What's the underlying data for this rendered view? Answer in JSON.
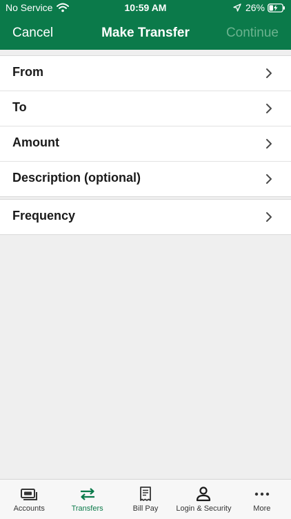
{
  "status_bar": {
    "carrier": "No Service",
    "time": "10:59 AM",
    "battery": "26%"
  },
  "nav": {
    "cancel_label": "Cancel",
    "title": "Make Transfer",
    "continue_label": "Continue"
  },
  "form": {
    "group1": [
      {
        "label": "From"
      },
      {
        "label": "To"
      },
      {
        "label": "Amount"
      },
      {
        "label": "Description (optional)"
      }
    ],
    "group2": [
      {
        "label": "Frequency"
      }
    ]
  },
  "tabbar": {
    "active": "Transfers",
    "items": [
      {
        "label": "Accounts",
        "icon": "accounts-icon"
      },
      {
        "label": "Transfers",
        "icon": "transfers-icon"
      },
      {
        "label": "Bill Pay",
        "icon": "bill-pay-icon"
      },
      {
        "label": "Login & Security",
        "icon": "login-security-icon"
      },
      {
        "label": "More",
        "icon": "more-icon"
      }
    ]
  },
  "colors": {
    "brand": "#0b7a4a",
    "continue_disabled": "#6bb38f",
    "background": "#efefef"
  }
}
